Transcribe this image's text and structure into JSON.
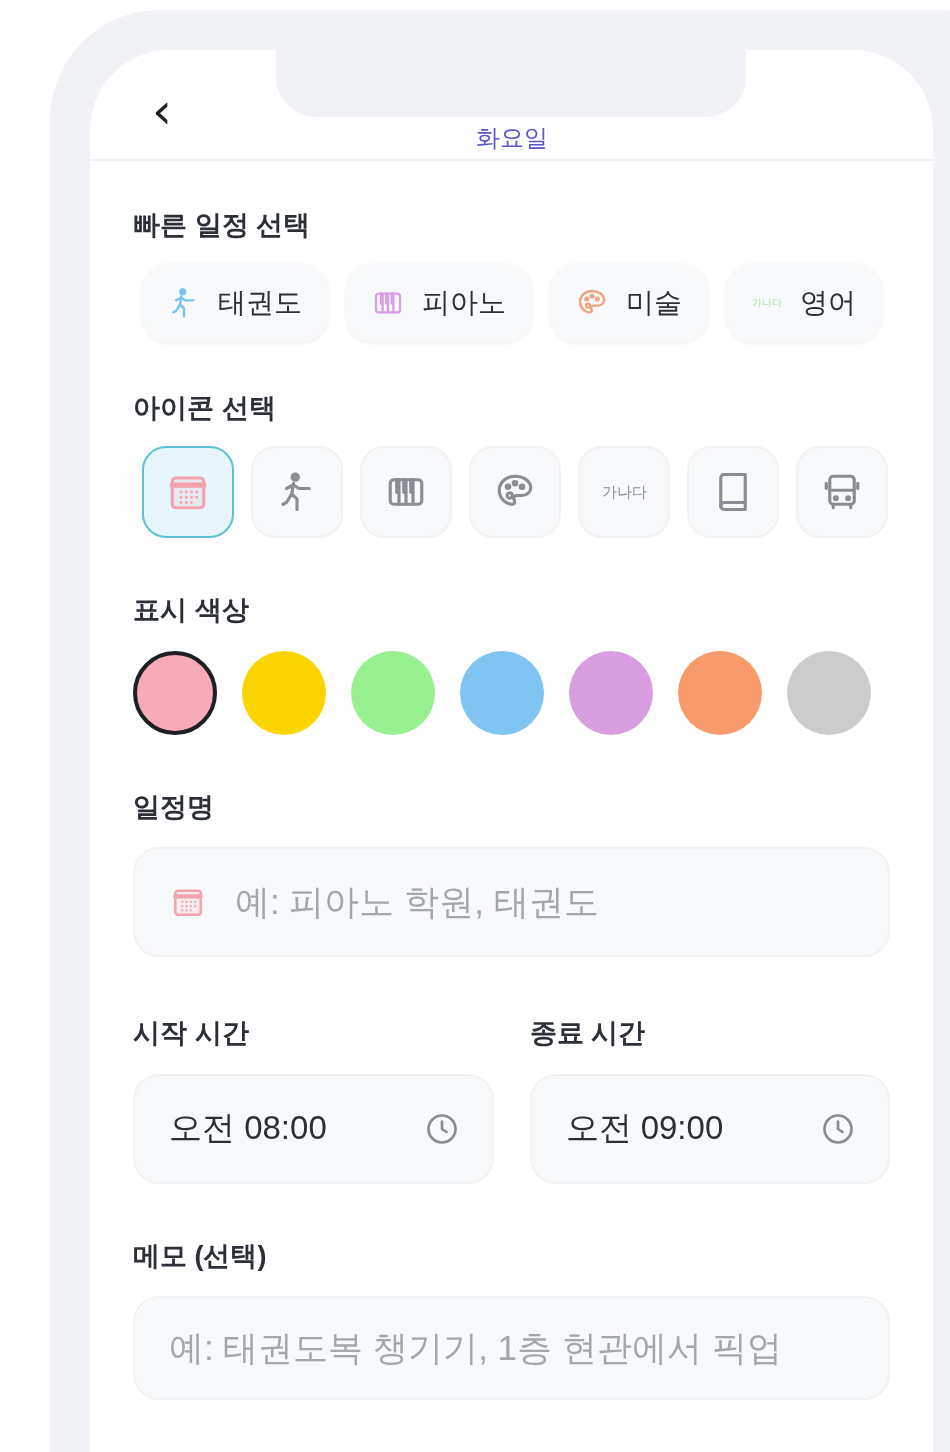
{
  "header": {
    "back": "‹",
    "title": "화요일"
  },
  "quick": {
    "label": "빠른 일정 선택",
    "items": [
      {
        "kind": "figure",
        "color": "#7cc4f0",
        "label": "태권도"
      },
      {
        "kind": "piano",
        "color": "#d9a0e6",
        "label": "피아노"
      },
      {
        "kind": "palette",
        "color": "#f2a27c",
        "label": "미술"
      },
      {
        "kind": "text",
        "icon_text": "가나다",
        "color": "#a8e6a0",
        "label": "영어"
      }
    ]
  },
  "icons": {
    "label": "아이콘 선택",
    "items": [
      {
        "kind": "calendar",
        "selected": true
      },
      {
        "kind": "figure",
        "selected": false
      },
      {
        "kind": "piano",
        "selected": false
      },
      {
        "kind": "palette",
        "selected": false
      },
      {
        "kind": "text",
        "text": "가나다",
        "selected": false
      },
      {
        "kind": "book",
        "selected": false
      },
      {
        "kind": "bus",
        "selected": false
      }
    ]
  },
  "colors": {
    "label": "표시 색상",
    "items": [
      {
        "color": "#f9aab8",
        "selected": true
      },
      {
        "color": "#fcd400",
        "selected": false
      },
      {
        "color": "#98f090",
        "selected": false
      },
      {
        "color": "#80c4f4",
        "selected": false
      },
      {
        "color": "#d89ee0",
        "selected": false
      },
      {
        "color": "#f99a6c",
        "selected": false
      },
      {
        "color": "#cccccc",
        "selected": false
      }
    ]
  },
  "name": {
    "label": "일정명",
    "placeholder": "예: 피아노 학원, 태권도"
  },
  "start": {
    "label": "시작 시간",
    "value": "오전 08:00"
  },
  "end": {
    "label": "종료 시간",
    "value": "오전 09:00"
  },
  "memo": {
    "label": "메모 (선택)",
    "placeholder": "예: 태권도복 챙기기, 1층 현관에서 픽업"
  }
}
